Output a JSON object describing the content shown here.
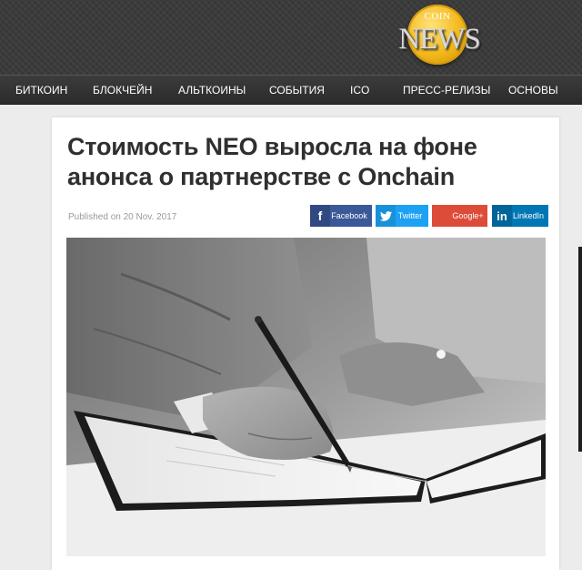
{
  "logo": {
    "coin_text": "COIN",
    "news_text": "NEWS"
  },
  "nav": {
    "items": [
      {
        "label": "БИТКОИН"
      },
      {
        "label": "БЛОКЧЕЙН"
      },
      {
        "label": "АЛЬТКОИНЫ"
      },
      {
        "label": "СОБЫТИЯ"
      },
      {
        "label": "ICO"
      },
      {
        "label": "ПРЕСС-РЕЛИЗЫ"
      },
      {
        "label": "ОСНОВЫ"
      }
    ]
  },
  "article": {
    "title": "Стоимость NEO выросла на фоне анонса о партнерстве с Onchain",
    "published": "Published on 20 Nov. 2017",
    "image_icon": "photo-hand-signing-document"
  },
  "share": {
    "facebook": {
      "label": "Facebook",
      "icon": "facebook-icon",
      "color": "#3b5998"
    },
    "twitter": {
      "label": "Twitter",
      "icon": "twitter-icon",
      "color": "#1da1f2"
    },
    "google": {
      "label": "Google+",
      "icon": "google-plus-icon",
      "color": "#dd4b39"
    },
    "linkedin": {
      "label": "LinkedIn",
      "icon": "linkedin-icon",
      "color": "#0077b5"
    }
  }
}
